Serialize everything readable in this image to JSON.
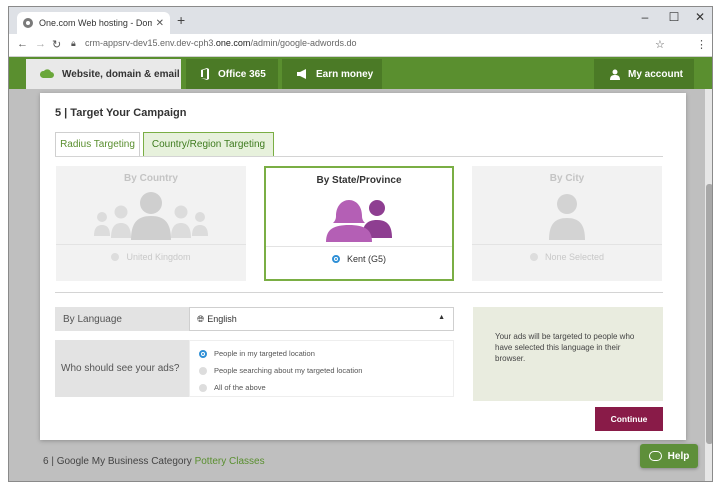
{
  "browser": {
    "tab_title": "One.com Web hosting - Domai",
    "tab_close": "✕",
    "new_tab": "+",
    "url_prefix": "crm-appsrv-dev15.env.dev-cph3.",
    "url_domain": "one.com",
    "url_path": "/admin/google-adwords.do"
  },
  "site_nav": {
    "tabs": [
      {
        "label": "Website, domain & email",
        "icon": "cloud-icon"
      },
      {
        "label": "Office 365",
        "icon": "office-icon"
      },
      {
        "label": "Earn money",
        "icon": "megaphone-icon"
      }
    ],
    "account_label": "My account"
  },
  "modal": {
    "title": "5 | Target Your Campaign",
    "tabs": [
      "Radius Targeting",
      "Country/Region Targeting"
    ],
    "cards": [
      {
        "title": "By Country",
        "option": "United Kingdom",
        "selected": false
      },
      {
        "title": "By State/Province",
        "option": "Kent (G5)",
        "selected": true
      },
      {
        "title": "By City",
        "option": "None Selected",
        "selected": false
      }
    ],
    "language_label": "By Language",
    "language_value": "English",
    "audience_label": "Who should see your ads?",
    "audience_options": [
      {
        "label": "People in my targeted location",
        "checked": true
      },
      {
        "label": "People searching about my targeted location",
        "checked": false
      },
      {
        "label": "All of the above",
        "checked": false
      }
    ],
    "info_text": "Your ads will be targeted to people who have selected this language in their browser.",
    "continue_label": "Continue"
  },
  "footer": {
    "step_text": "6 | Google My Business Category ",
    "category_link": "Pottery Classes",
    "help_label": "Help"
  },
  "colors": {
    "brand_green": "#5a8f2f",
    "selected_purple": "#a74ea8",
    "continue_bg": "#891b48"
  }
}
